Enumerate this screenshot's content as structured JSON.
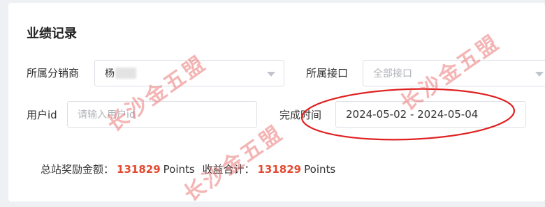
{
  "page": {
    "title": "业绩记录"
  },
  "filters": {
    "distributor": {
      "label": "所属分销商",
      "value": "杨"
    },
    "interface": {
      "label": "所属接口",
      "placeholder": "全部接口"
    },
    "user_id": {
      "label": "用户id",
      "placeholder": "请输入用户id"
    },
    "completion_time": {
      "label": "完成时间",
      "value": "2024-05-02 - 2024-05-04"
    }
  },
  "summary": {
    "total_reward_label": "总站奖励金额：",
    "total_reward_value": "131829",
    "total_reward_unit": "Points",
    "income_total_label": "收益合计：",
    "income_total_value": "131829",
    "income_total_unit": "Points"
  },
  "watermark": {
    "text": "长沙金五盟",
    "color": "#e65a5a"
  },
  "annotation": {
    "circle_color": "#e02020"
  },
  "colors": {
    "accent": "#e2492f",
    "placeholder": "#b0b3b8",
    "border": "#dcdfe6"
  },
  "icons": [
    "chevron-down-icon"
  ]
}
